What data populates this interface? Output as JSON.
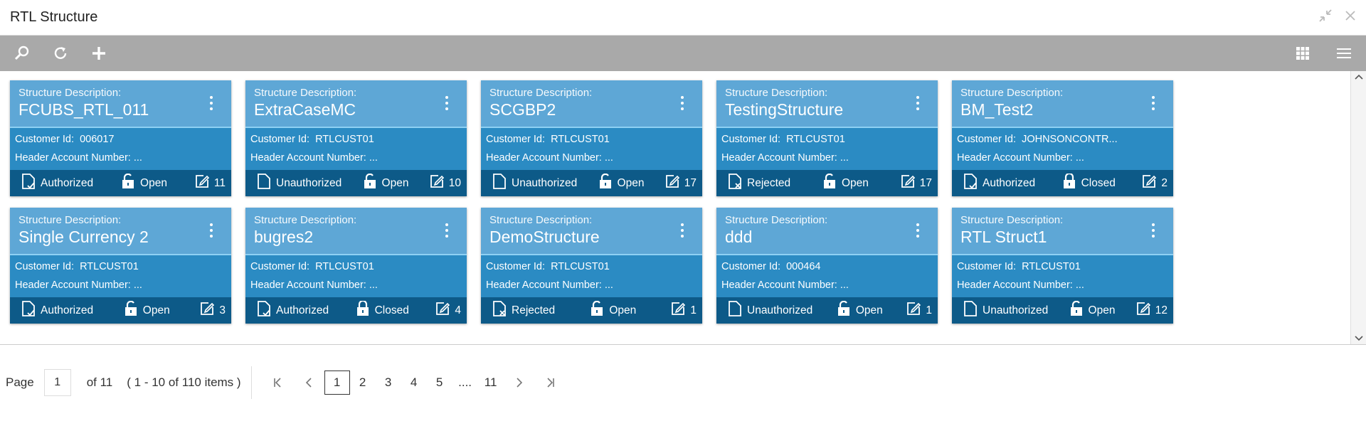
{
  "window": {
    "title": "RTL Structure"
  },
  "card_label": "Structure Description:",
  "customer_label": "Customer Id:",
  "header_label": "Header Account Number:",
  "cards": [
    {
      "title": "FCUBS_RTL_011",
      "customer_id": "006017",
      "header_account": "...",
      "auth": "Authorized",
      "status": "Open",
      "count": "11"
    },
    {
      "title": "ExtraCaseMC",
      "customer_id": "RTLCUST01",
      "header_account": "...",
      "auth": "Unauthorized",
      "status": "Open",
      "count": "10"
    },
    {
      "title": "SCGBP2",
      "customer_id": "RTLCUST01",
      "header_account": "...",
      "auth": "Unauthorized",
      "status": "Open",
      "count": "17"
    },
    {
      "title": "TestingStructure",
      "customer_id": "RTLCUST01",
      "header_account": "...",
      "auth": "Rejected",
      "status": "Open",
      "count": "17"
    },
    {
      "title": "BM_Test2",
      "customer_id": "JOHNSONCONTR...",
      "header_account": "...",
      "auth": "Authorized",
      "status": "Closed",
      "count": "2"
    },
    {
      "title": "Single Currency 2",
      "customer_id": "RTLCUST01",
      "header_account": "...",
      "auth": "Authorized",
      "status": "Open",
      "count": "3"
    },
    {
      "title": "bugres2",
      "customer_id": "RTLCUST01",
      "header_account": "...",
      "auth": "Authorized",
      "status": "Closed",
      "count": "4"
    },
    {
      "title": "DemoStructure",
      "customer_id": "RTLCUST01",
      "header_account": "...",
      "auth": "Rejected",
      "status": "Open",
      "count": "1"
    },
    {
      "title": "ddd",
      "customer_id": "000464",
      "header_account": "...",
      "auth": "Unauthorized",
      "status": "Open",
      "count": "1"
    },
    {
      "title": "RTL Struct1",
      "customer_id": "RTLCUST01",
      "header_account": "...",
      "auth": "Unauthorized",
      "status": "Open",
      "count": "12"
    }
  ],
  "pagination": {
    "page_label": "Page",
    "current_page": "1",
    "of_label": "of 11",
    "range_label": "( 1 - 10 of 110 items )",
    "pages": [
      "1",
      "2",
      "3",
      "4",
      "5",
      "....",
      "11"
    ]
  },
  "icons": [
    "search-icon",
    "refresh-icon",
    "add-icon",
    "grid-view-icon",
    "list-view-icon",
    "minimize-icon",
    "close-icon"
  ],
  "colors": {
    "toolbar": "#a9a9a9",
    "card_top": "#5ea7d6",
    "card_mid": "#2b8bc3",
    "card_bottom": "#0d5a88"
  }
}
